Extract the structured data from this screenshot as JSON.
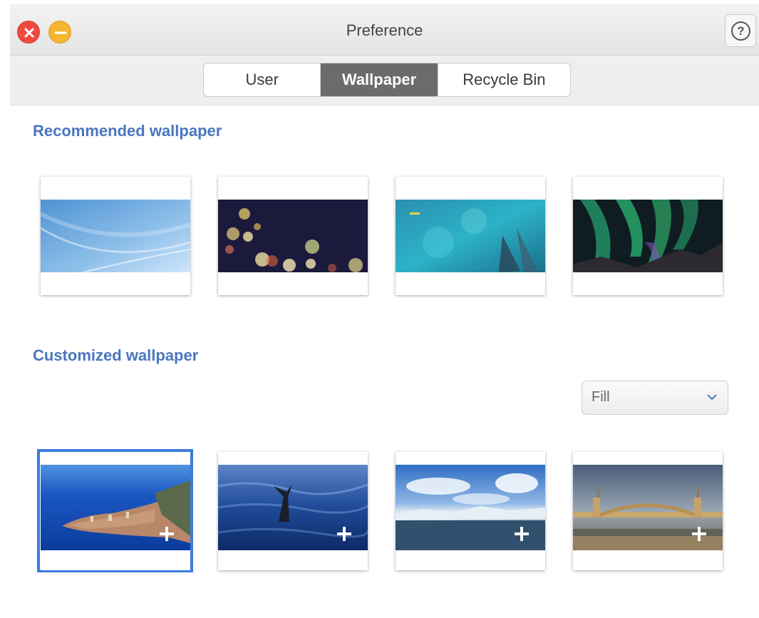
{
  "window": {
    "title": "Preference"
  },
  "titlebar": {
    "close_icon": "close-icon",
    "minimize_icon": "minimize-icon",
    "help_glyph": "?"
  },
  "tabs": [
    {
      "label": "User",
      "active": false
    },
    {
      "label": "Wallpaper",
      "active": true
    },
    {
      "label": "Recycle Bin",
      "active": false
    }
  ],
  "recommended": {
    "title": "Recommended wallpaper",
    "items": [
      {
        "name": "blue-gradient-waves"
      },
      {
        "name": "bokeh-night-lights"
      },
      {
        "name": "turquoise-ice"
      },
      {
        "name": "aurora-borealis"
      }
    ]
  },
  "customized": {
    "title": "Customized wallpaper",
    "fit_select": {
      "value": "Fill"
    },
    "items": [
      {
        "name": "coastal-old-town",
        "selected": true,
        "add_glyph": "+"
      },
      {
        "name": "whale-tail",
        "selected": false,
        "add_glyph": "+"
      },
      {
        "name": "glacier-lagoon",
        "selected": false,
        "add_glyph": "+"
      },
      {
        "name": "arch-bridge",
        "selected": false,
        "add_glyph": "+"
      }
    ]
  },
  "colors": {
    "accent": "#4a76bf",
    "selection": "#3d7bde",
    "active_tab": "#6b6b6b"
  }
}
